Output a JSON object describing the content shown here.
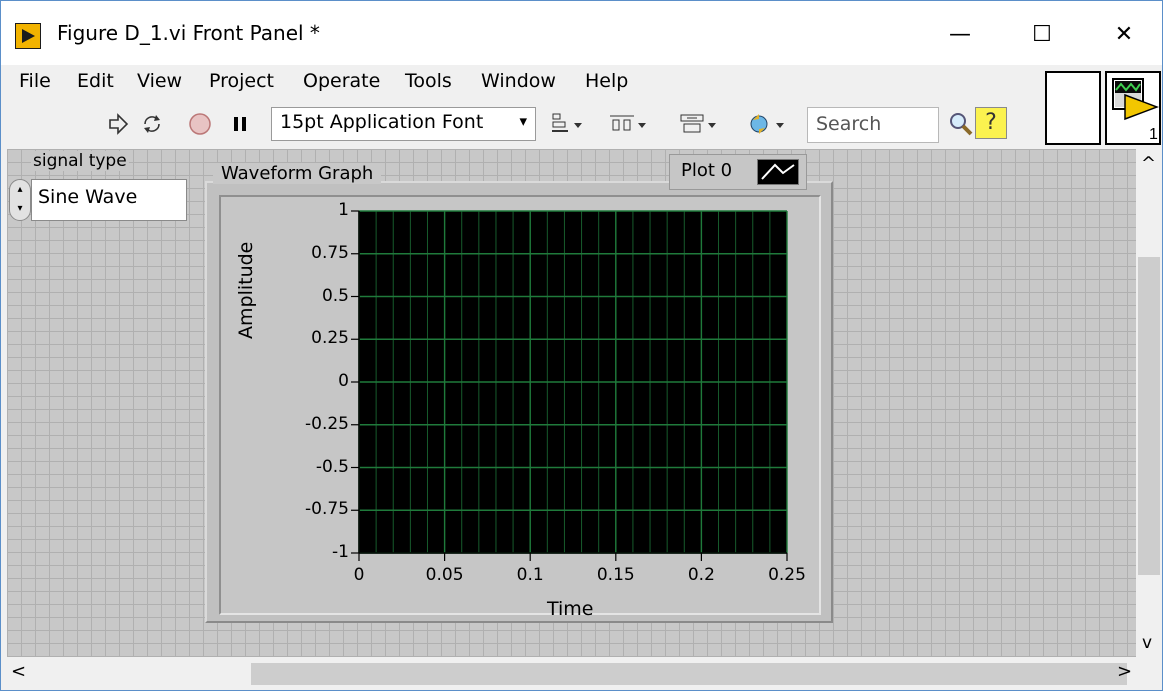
{
  "window": {
    "title": "Figure D_1.vi Front Panel *",
    "controls": {
      "minimize": "—",
      "maximize": "☐",
      "close": "✕"
    }
  },
  "menu": [
    "File",
    "Edit",
    "View",
    "Project",
    "Operate",
    "Tools",
    "Window",
    "Help"
  ],
  "toolbar": {
    "font": "15pt Application Font",
    "font_arrow": "▾",
    "search_placeholder": "Search",
    "help": "?",
    "icons": [
      "run-arrow",
      "run-continuously",
      "abort",
      "pause",
      "align-objects",
      "distribute-objects",
      "resize-objects",
      "reorder",
      "search",
      "context-help"
    ]
  },
  "signal_type": {
    "label": "signal type",
    "value": "Sine Wave"
  },
  "graph": {
    "title": "Waveform Graph",
    "legend_plot": "Plot 0"
  },
  "chart_data": {
    "type": "line",
    "title": "Waveform Graph",
    "xlabel": "Time",
    "ylabel": "Amplitude",
    "xlim": [
      0,
      0.25
    ],
    "ylim": [
      -1,
      1
    ],
    "x_ticks": [
      "0",
      "0.05",
      "0.1",
      "0.15",
      "0.2",
      "0.25"
    ],
    "y_ticks": [
      "1",
      "0.75",
      "0.5",
      "0.25",
      "0",
      "-0.25",
      "-0.5",
      "-0.75",
      "-1"
    ],
    "grid": true,
    "plot_background": "#000000",
    "grid_color": "#1f7a3b",
    "series": []
  },
  "scroll": {
    "up": "^",
    "down": "v",
    "left": "<",
    "right": ">"
  }
}
